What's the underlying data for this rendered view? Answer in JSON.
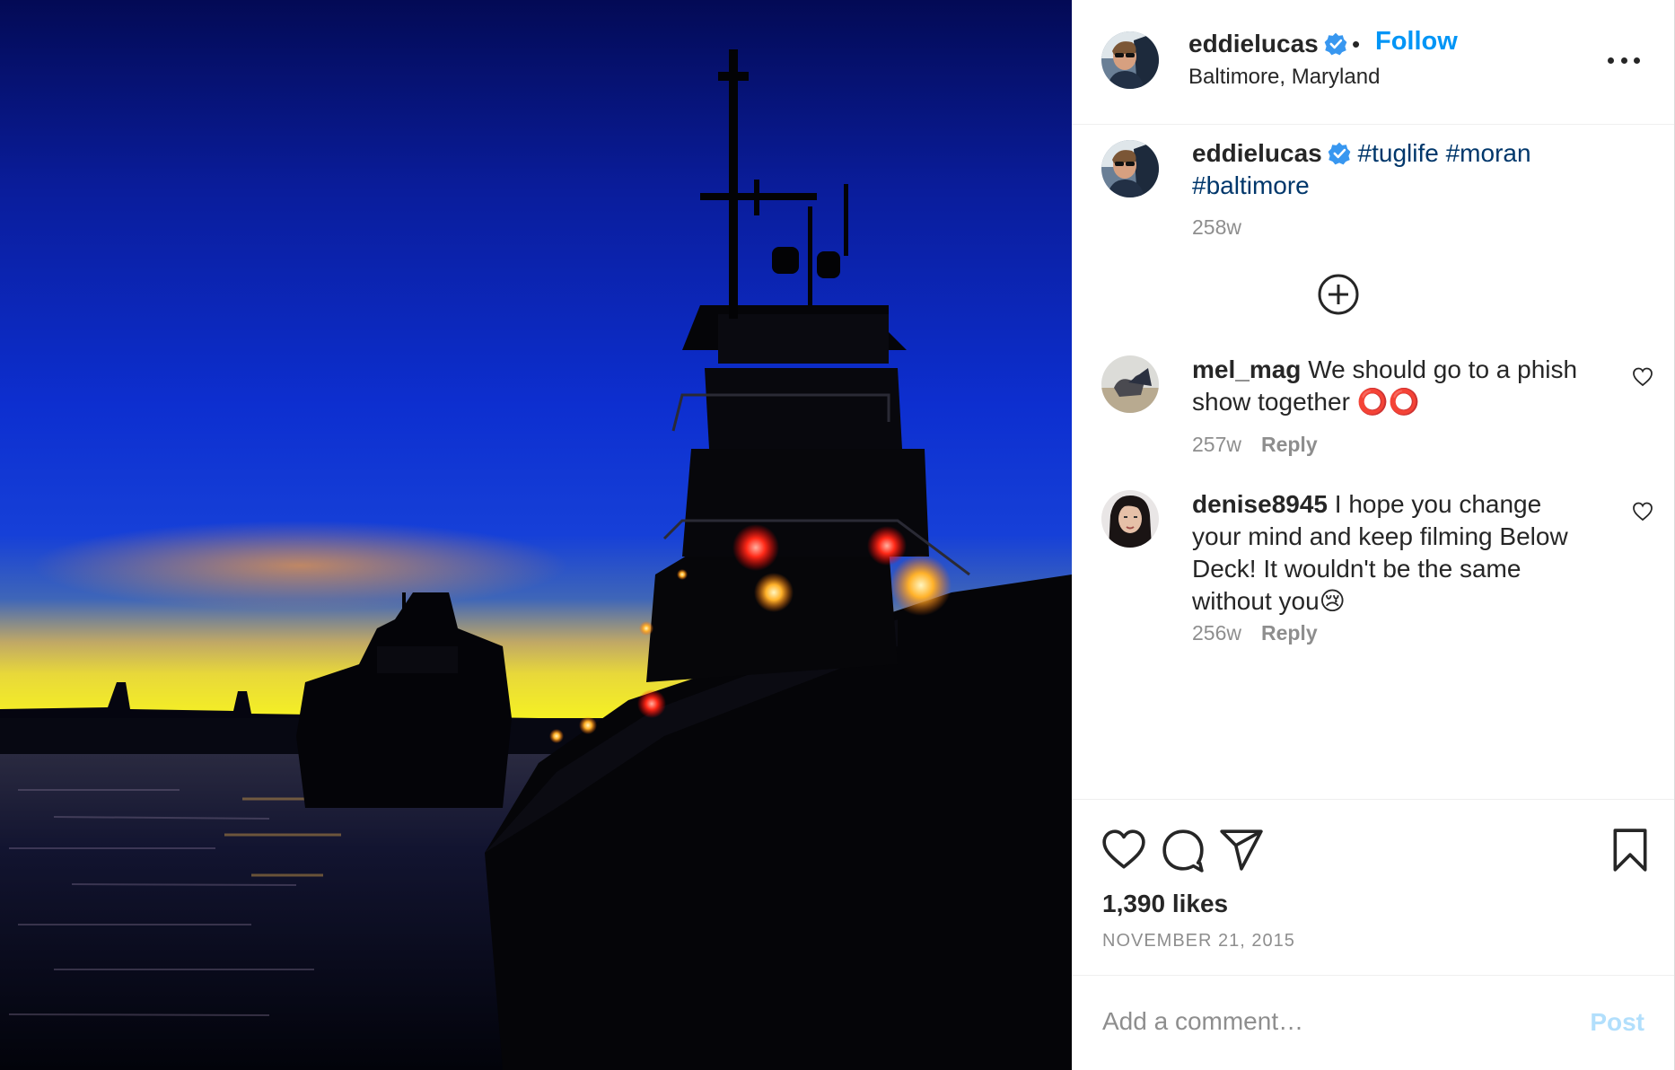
{
  "photo": {
    "subject": "tugboat-silhouette-sunset"
  },
  "header": {
    "username": "eddielucas",
    "separator": "•",
    "follow_label": "Follow",
    "location": "Baltimore, Maryland",
    "more_icon": "more-horizontal-icon"
  },
  "caption": {
    "username": "eddielucas",
    "hashtags": [
      "#tuglife",
      "#moran",
      "#baltimore"
    ],
    "time": "258w"
  },
  "load_more_icon": "plus-circle-icon",
  "comments": [
    {
      "username": "mel_mag",
      "text": "We should go to a phish show together",
      "emoji": "⭕⭕",
      "time": "257w",
      "reply_label": "Reply"
    },
    {
      "username": "denise8945",
      "text": "I hope you change your mind and keep filming Below Deck! It wouldn't be the same without you",
      "emoji": "😢",
      "time": "256w",
      "reply_label": "Reply"
    }
  ],
  "actions": {
    "likes": "1,390 likes",
    "date": "NOVEMBER 21, 2015"
  },
  "add_comment": {
    "placeholder": "Add a comment…",
    "post_label": "Post"
  },
  "colors": {
    "link_blue": "#0095f6",
    "hashtag_blue": "#00376b",
    "muted": "#8e8e8e",
    "post_disabled": "#b2dffc"
  }
}
